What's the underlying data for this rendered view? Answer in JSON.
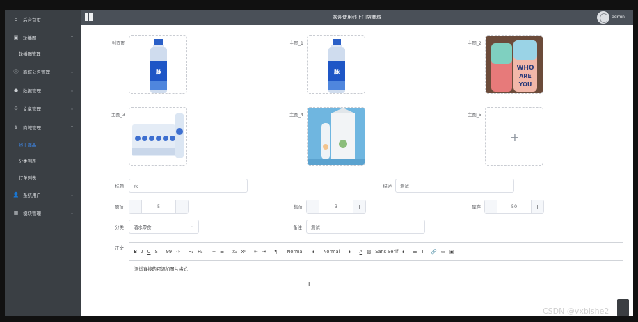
{
  "header": {
    "title": "欢迎使用线上门店商城",
    "user": "admin"
  },
  "sidebar": {
    "items": [
      {
        "label": "后台首页",
        "icon": "home-icon",
        "glyph": "⌂"
      },
      {
        "label": "轮播图",
        "icon": "image-icon",
        "glyph": "▣"
      },
      {
        "label": "商城公告管理",
        "icon": "notice-icon",
        "glyph": "ⓘ"
      },
      {
        "label": "数据管理",
        "icon": "data-icon",
        "glyph": "●"
      },
      {
        "label": "文章管理",
        "icon": "article-icon",
        "glyph": "⊙"
      },
      {
        "label": "商城管理",
        "icon": "cart-icon",
        "glyph": "⊻"
      },
      {
        "label": "系统用户",
        "icon": "user-icon",
        "glyph": "👤"
      },
      {
        "label": "模块管理",
        "icon": "grid-icon",
        "glyph": "▦"
      }
    ],
    "subitems": [
      {
        "label": "轮播图管理"
      },
      {
        "label": "线上商品"
      },
      {
        "label": "分类列表"
      },
      {
        "label": "订单列表"
      }
    ]
  },
  "form": {
    "cover_label": "封面图",
    "main1_label": "主图_1",
    "main2_label": "主图_2",
    "main3_label": "主图_3",
    "main4_label": "主图_4",
    "main5_label": "主图_5",
    "title_label": "标题",
    "title_value": "水",
    "desc_label": "描述",
    "desc_value": "测试",
    "price_label": "原价",
    "price_value": "5",
    "sale_label": "售价",
    "sale_value": "3",
    "stock_label": "库存",
    "stock_value": "50",
    "category_label": "分类",
    "category_value": "酒水零食",
    "remark_label": "备注",
    "remark_value": "测试",
    "content_label": "正文"
  },
  "editor": {
    "toolbar": [
      "B",
      "I",
      "U",
      "S",
      "99",
      "‹›",
      "H₁",
      "H₂",
      "≔",
      "☰",
      "x₂",
      "x²",
      "⇤",
      "⇥",
      "¶"
    ],
    "header_picker": "Normal",
    "size_picker": "Normal",
    "font_picker": "Sans Serif",
    "body_text": "测试直接的可添加图片格式"
  },
  "watermark": "CSDN @vxbishe2"
}
